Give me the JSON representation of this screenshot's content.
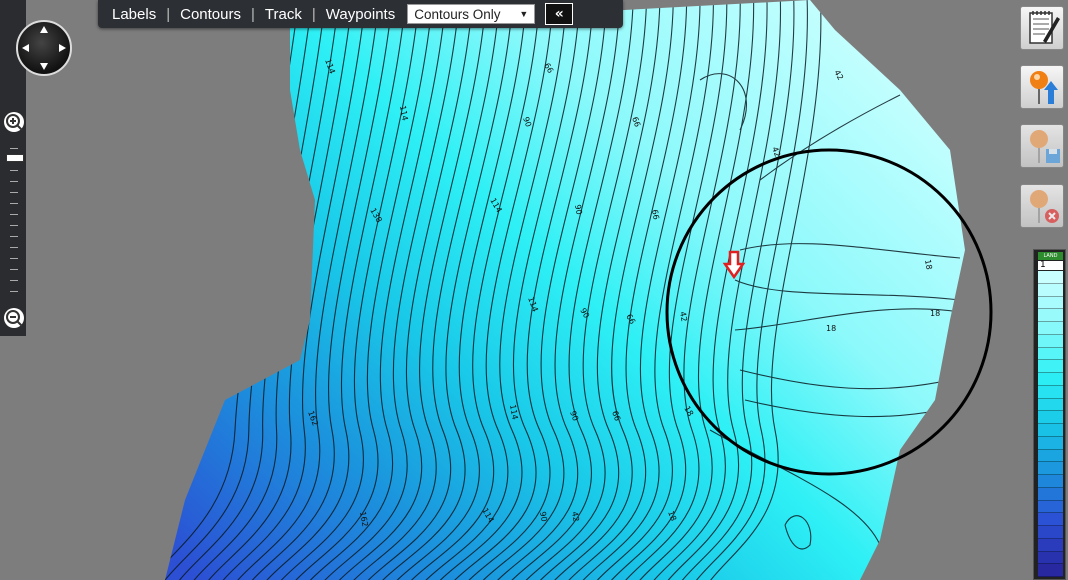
{
  "toolbar": {
    "links": [
      "Labels",
      "Contours",
      "Track",
      "Waypoints"
    ],
    "view_select": {
      "value": "Contours Only"
    },
    "collapse_glyph": "«"
  },
  "map": {
    "contour_labels": [
      "114",
      "114",
      "138",
      "162",
      "162",
      "114",
      "114",
      "114",
      "114",
      "90",
      "90",
      "90",
      "90",
      "90",
      "66",
      "66",
      "66",
      "66",
      "66",
      "42",
      "42",
      "42",
      "42",
      "18",
      "18",
      "18"
    ]
  },
  "legend": {
    "land_label": "LAND",
    "first_value": "1"
  },
  "icons": [
    "pan-control-icon",
    "zoom-in-icon",
    "zoom-out-icon",
    "notepad-icon",
    "add-waypoint-icon",
    "save-waypoint-icon",
    "delete-waypoint-icon",
    "location-arrow-icon"
  ],
  "colors": {
    "shallow": "#c9ffff",
    "mid": "#1ee6f2",
    "deep": "#2e55d8",
    "land": "#7d7d7d",
    "circle": "#000000",
    "marker": "#e02020"
  }
}
